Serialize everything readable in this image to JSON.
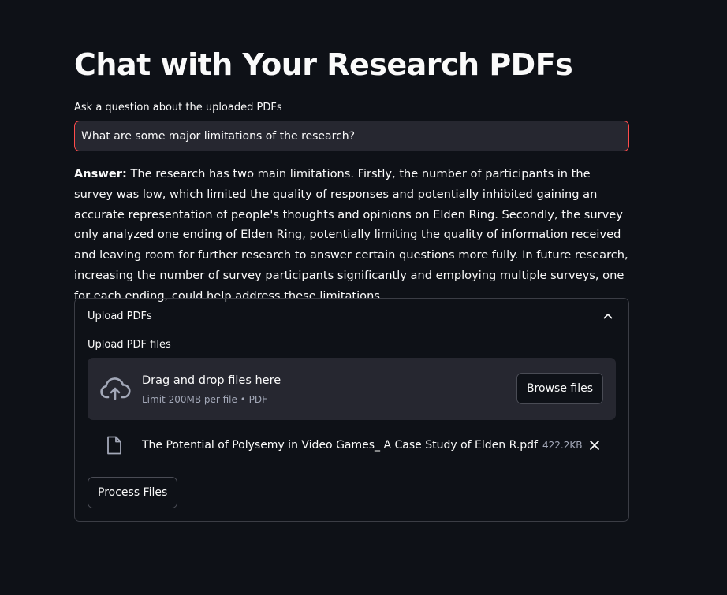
{
  "page": {
    "title": "Chat with Your Research PDFs"
  },
  "question": {
    "label": "Ask a question about the uploaded PDFs",
    "value": "What are some major limitations of the research?"
  },
  "answer": {
    "prefix": "Answer:",
    "text": "The research has two main limitations. Firstly, the number of participants in the survey was low, which limited the quality of responses and potentially inhibited gaining an accurate representation of people's thoughts and opinions on Elden Ring. Secondly, the survey only analyzed one ending of Elden Ring, potentially limiting the quality of information received and leaving room for further research to answer certain questions more fully. In future research, increasing the number of survey participants significantly and employing multiple surveys, one for each ending, could help address these limitations."
  },
  "expander": {
    "title": "Upload PDFs",
    "expanded": true,
    "uploader": {
      "label": "Upload PDF files",
      "drop_title": "Drag and drop files here",
      "limit_text": "Limit 200MB per file • PDF",
      "browse_label": "Browse files",
      "icon": "cloud-upload-icon"
    },
    "files": [
      {
        "name": "The Potential of Polysemy in Video Games_ A Case Study of Elden R.pdf",
        "size": "422.2KB",
        "icon": "file-icon"
      }
    ],
    "process_label": "Process Files"
  },
  "colors": {
    "background": "#0e1117",
    "surface": "#262730",
    "accent_border": "#ff4b4b",
    "text": "#fafafa",
    "muted": "#a3a8b8"
  }
}
